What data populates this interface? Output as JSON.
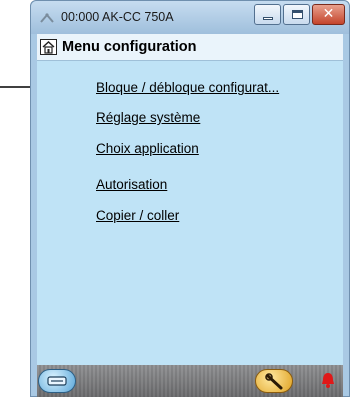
{
  "window": {
    "title": "00:000 AK-CC 750A"
  },
  "header": {
    "title": "Menu configuration"
  },
  "menu": {
    "items": [
      {
        "label": "Bloque / débloque configurat..."
      },
      {
        "label": "Réglage système"
      },
      {
        "label": "Choix application"
      },
      {
        "label": "Autorisation"
      },
      {
        "label": "Copier / coller"
      }
    ]
  },
  "bottombar": {
    "left_icon": "device-icon",
    "tool_icon": "wrench-icon",
    "alarm_icon": "alarm-bell-icon"
  },
  "colors": {
    "client_bg": "#bfe3f6",
    "header_bg": "#eaf4fb",
    "close_button": "#c4452c",
    "alarm": "#e01818"
  }
}
